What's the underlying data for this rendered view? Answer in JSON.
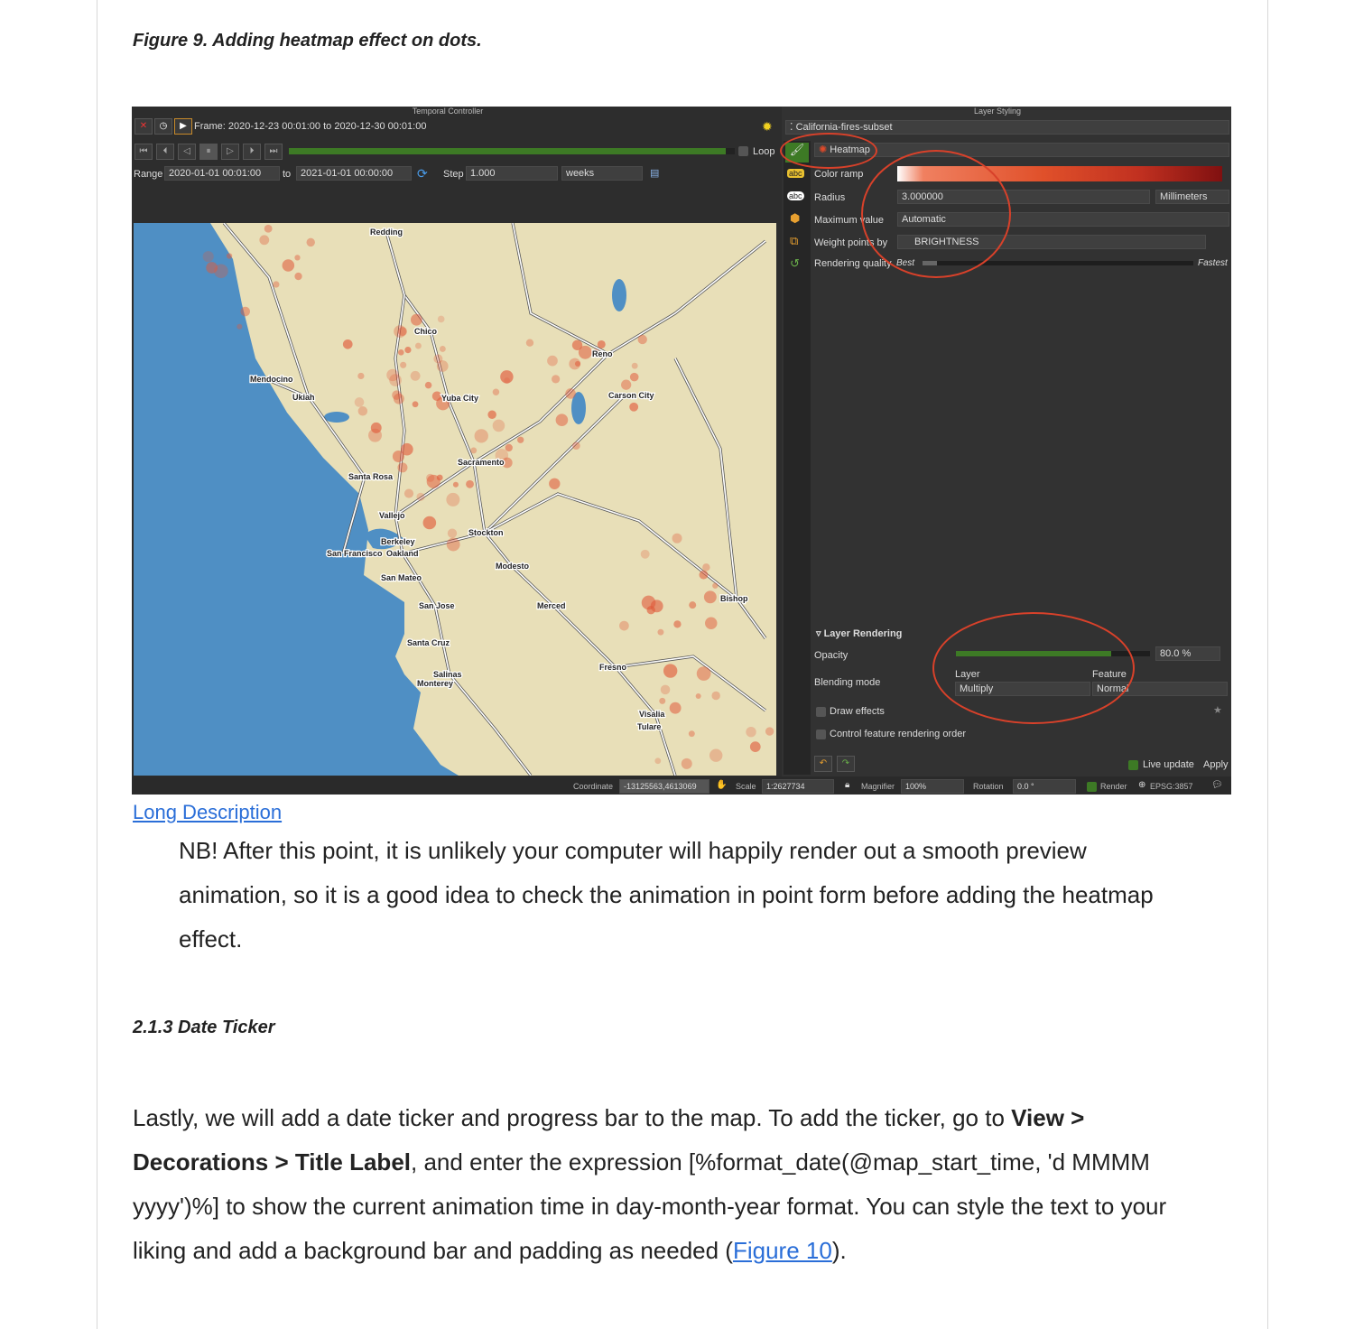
{
  "caption": "Figure 9. Adding heatmap effect on dots.",
  "screenshot": {
    "temporal": {
      "title": "Temporal Controller",
      "frame": "Frame: 2020-12-23 00:01:00 to 2020-12-30 00:01:00",
      "loop": "Loop",
      "range_label": "Range",
      "range_start": "2020-01-01 00:01:00",
      "to": "to",
      "range_end": "2021-01-01 00:00:00",
      "step_label": "Step",
      "step": "1.000",
      "unit": "weeks",
      "progress": 0.98
    },
    "map_cities": [
      "Redding",
      "Chico",
      "Mendocino",
      "Ukiah",
      "Yuba City",
      "Reno",
      "Carson City",
      "Sacramento",
      "Santa Rosa",
      "Vallejo",
      "Stockton",
      "Berkeley",
      "San Francisco",
      "Oakland",
      "Modesto",
      "San Mateo",
      "Bishop",
      "San Jose",
      "Merced",
      "Santa Cruz",
      "Fresno",
      "Salinas",
      "Monterey",
      "Visalia",
      "Tulare"
    ],
    "styling": {
      "title": "Layer Styling",
      "layer": "California-fires-subset",
      "renderer": "Heatmap",
      "color_ramp": "Color ramp",
      "radius_label": "Radius",
      "radius": "3.000000",
      "radius_unit": "Millimeters",
      "max_label": "Maximum value",
      "max": "Automatic",
      "weight_label": "Weight points by",
      "weight": "BRIGHTNESS",
      "quality_label": "Rendering quality",
      "best": "Best",
      "fastest": "Fastest",
      "layer_rendering": "Layer Rendering",
      "opacity_label": "Opacity",
      "opacity": "80.0 %",
      "opacity_value": 0.8,
      "blending_label": "Blending mode",
      "layer_col": "Layer",
      "feature_col": "Feature",
      "layer_blend": "Multiply",
      "feature_blend": "Normal",
      "draw_effects": "Draw effects",
      "control_order": "Control feature rendering order",
      "live_update": "Live update",
      "apply": "Apply"
    },
    "status": {
      "coordinate_label": "Coordinate",
      "coordinate": "-13125563,4613069",
      "scale_label": "Scale",
      "scale": "1:2627734",
      "magnifier_label": "Magnifier",
      "magnifier": "100%",
      "rotation_label": "Rotation",
      "rotation": "0.0 °",
      "render": "Render",
      "crs": "EPSG:3857"
    },
    "colors": {
      "accent_green": "#3d7a25",
      "highlight_red": "#d8412a",
      "ocean": "#4f8fc4",
      "land": "#e8dfb8"
    }
  },
  "long_description": "Long Description",
  "nb_text": "NB! After this point, it is unlikely your computer will happily render out a smooth preview animation, so it is a good idea to check the animation in point form before adding the heatmap effect.",
  "section_heading": "2.1.3 Date Ticker",
  "para": {
    "t1": "Lastly, we will add a date ticker and progress bar to the map. To add the ticker, go to ",
    "b1": "View > Decorations > Title Label",
    "t2": ", and enter the expression [%format_date(@map_start_time, 'd MMMM yyyy')%] to show the current animation time in day-month-year format. You can style the text to your liking and add a background bar and padding as needed (",
    "link": "Figure 10",
    "t3": ")."
  }
}
